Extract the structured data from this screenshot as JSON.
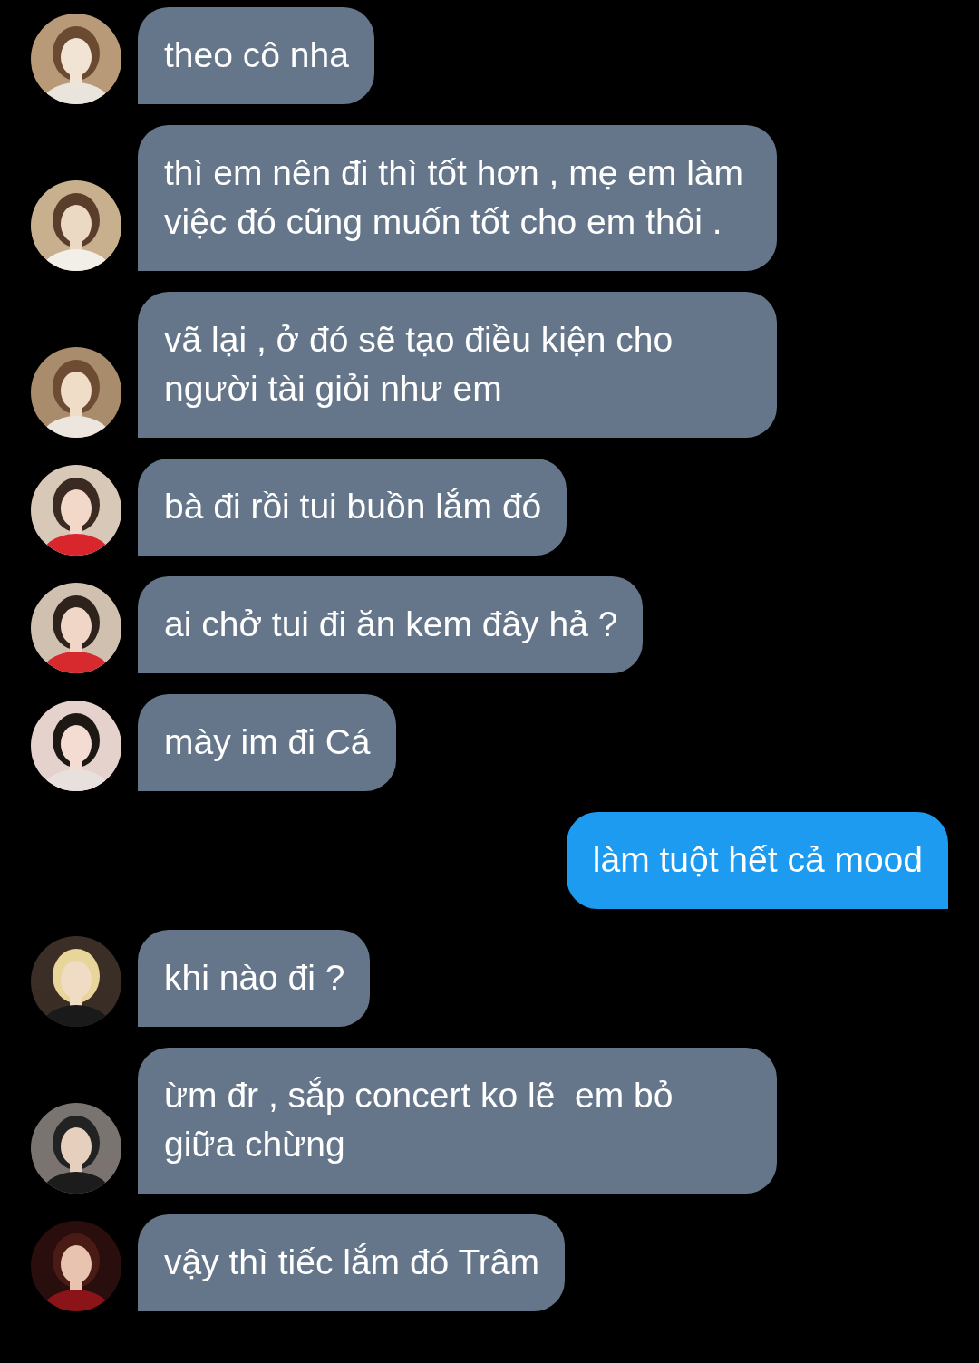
{
  "messages": [
    {
      "kind": "incoming",
      "text": "theo cô nha"
    },
    {
      "kind": "incoming",
      "text": "thì em nên đi thì tốt hơn , mẹ em làm việc đó cũng muốn tốt cho em thôi ."
    },
    {
      "kind": "incoming",
      "text": "vã lại , ở đó sẽ tạo điều kiện cho người tài giỏi như em"
    },
    {
      "kind": "incoming",
      "text": "bà đi rồi tui buồn lắm đó"
    },
    {
      "kind": "incoming",
      "text": "ai chở tui đi ăn kem đây hả ?"
    },
    {
      "kind": "incoming",
      "text": "mày im đi Cá"
    },
    {
      "kind": "outgoing",
      "text": "làm tuột hết cả mood"
    },
    {
      "kind": "incoming",
      "text": "khi nào đi ?"
    },
    {
      "kind": "incoming",
      "text": "ừm đr , sắp concert ko lẽ  em bỏ giữa chừng"
    },
    {
      "kind": "incoming",
      "text": "vậy thì tiếc lắm đó Trâm"
    }
  ]
}
